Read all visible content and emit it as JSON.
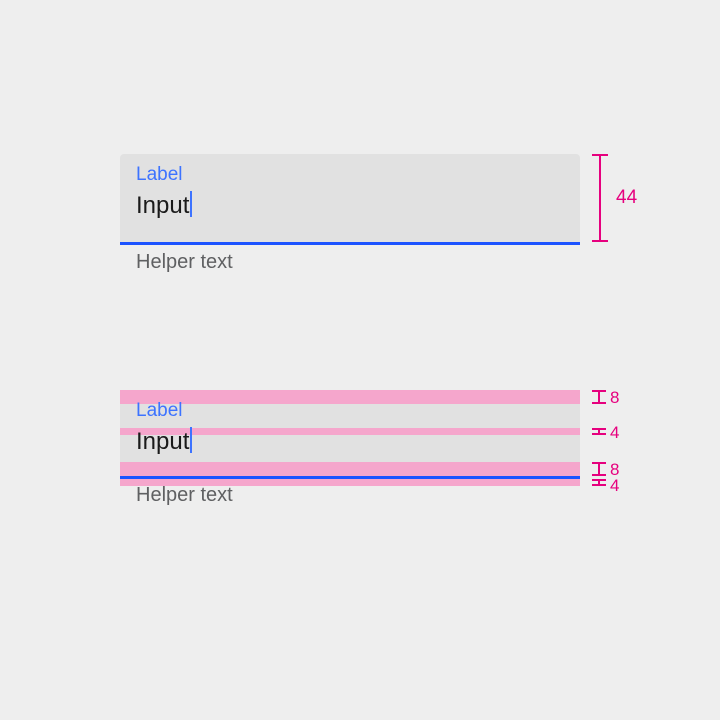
{
  "colors": {
    "background": "#eeeeee",
    "field_background": "#e1e1e1",
    "label": "#3d73ff",
    "underline": "#1c53ff",
    "caret": "#3d73ff",
    "helper_text": "#5f6062",
    "annotation_band": "#f5a6cc",
    "annotation_text": "#e6007e"
  },
  "field_clean": {
    "label": "Label",
    "input_value": "Input",
    "helper": "Helper text",
    "measurement_label": "44"
  },
  "field_annotated": {
    "label": "Label",
    "input_value": "Input",
    "helper": "Helper text",
    "spacing": {
      "top_padding": "8",
      "label_to_input": "4",
      "input_to_underline": "8",
      "underline_to_helper": "4"
    }
  }
}
